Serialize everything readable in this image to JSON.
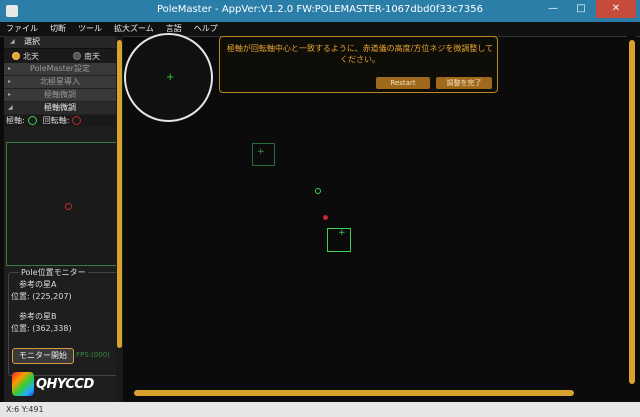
{
  "window": {
    "title": "PoleMaster - AppVer:V1.2.0 FW:POLEMASTER-1067dbd0f33c7356"
  },
  "menu": [
    "ファイル",
    "切断",
    "ツール",
    "拡大ズーム",
    "言語",
    "ヘルプ"
  ],
  "sidebar": {
    "select_header": "選択",
    "hemisphere": {
      "north": "北天",
      "south": "南天",
      "selected": "north"
    },
    "items": [
      "PoleMaster設定",
      "北極星導入",
      "極軸微調",
      "極軸微調"
    ],
    "axis_row": {
      "polar_label": "極軸:",
      "rotation_label": "回転軸:"
    },
    "monitor": {
      "legend": "Pole位置モニター",
      "star_a_label": "参考の星A",
      "star_a_pos": "位置: (225,207)",
      "star_b_label": "参考の星B",
      "star_b_pos": "位置: (362,338)",
      "start_button": "モニター開始",
      "status": "FPS:(000)"
    },
    "logo_text": "QHYCCD"
  },
  "message": {
    "text": "極軸が回転軸中心と一致するように、赤道儀の高度/方位ネジを微調整してください。",
    "restart_label": "Restart",
    "done_label": "調整を完了"
  },
  "statusbar": {
    "coords": "X:6 Y:491"
  },
  "colors": {
    "accent": "#d9a12e",
    "titlebar": "#2a7ea8",
    "marker_green": "#3ed050",
    "marker_red": "#c0282e"
  }
}
